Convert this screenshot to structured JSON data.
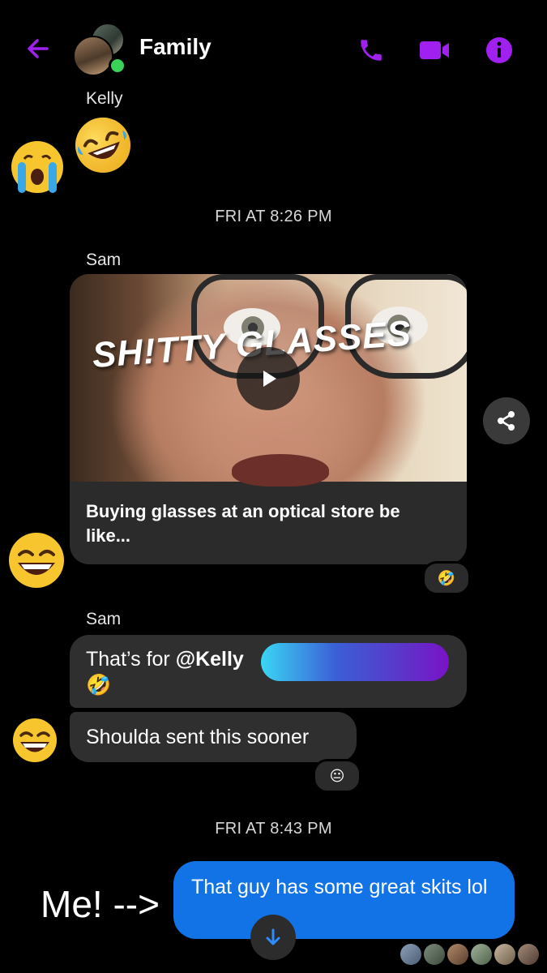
{
  "header": {
    "title": "Family",
    "icons": [
      "back-arrow-icon",
      "phone-icon",
      "video-camera-icon",
      "info-icon"
    ],
    "accent": "#a020f0"
  },
  "messages": {
    "kelly_sender": "Kelly",
    "timestamp_1": "FRI AT 8:26 PM",
    "sam_sender_1": "Sam",
    "video": {
      "overlay_text": "SH!TTY GLASSES",
      "caption": "Buying glasses at an optical store be like..."
    },
    "sam_sender_2": "Sam",
    "mention_message": {
      "prefix": "That’s for ",
      "mention": "@Kelly",
      "emoji": "🤣"
    },
    "message_sooner": "Shoulda sent this sooner",
    "reaction_video": "🤣",
    "reaction_sooner": "😐",
    "timestamp_2": "FRI AT 8:43 PM",
    "me_label": "Me! -->",
    "my_message": "That guy has some great skits lol"
  },
  "colors": {
    "background": "#000000",
    "grey_bubble": "#2f2f2f",
    "blue_bubble": "#1273e6",
    "online": "#3ad35a"
  }
}
